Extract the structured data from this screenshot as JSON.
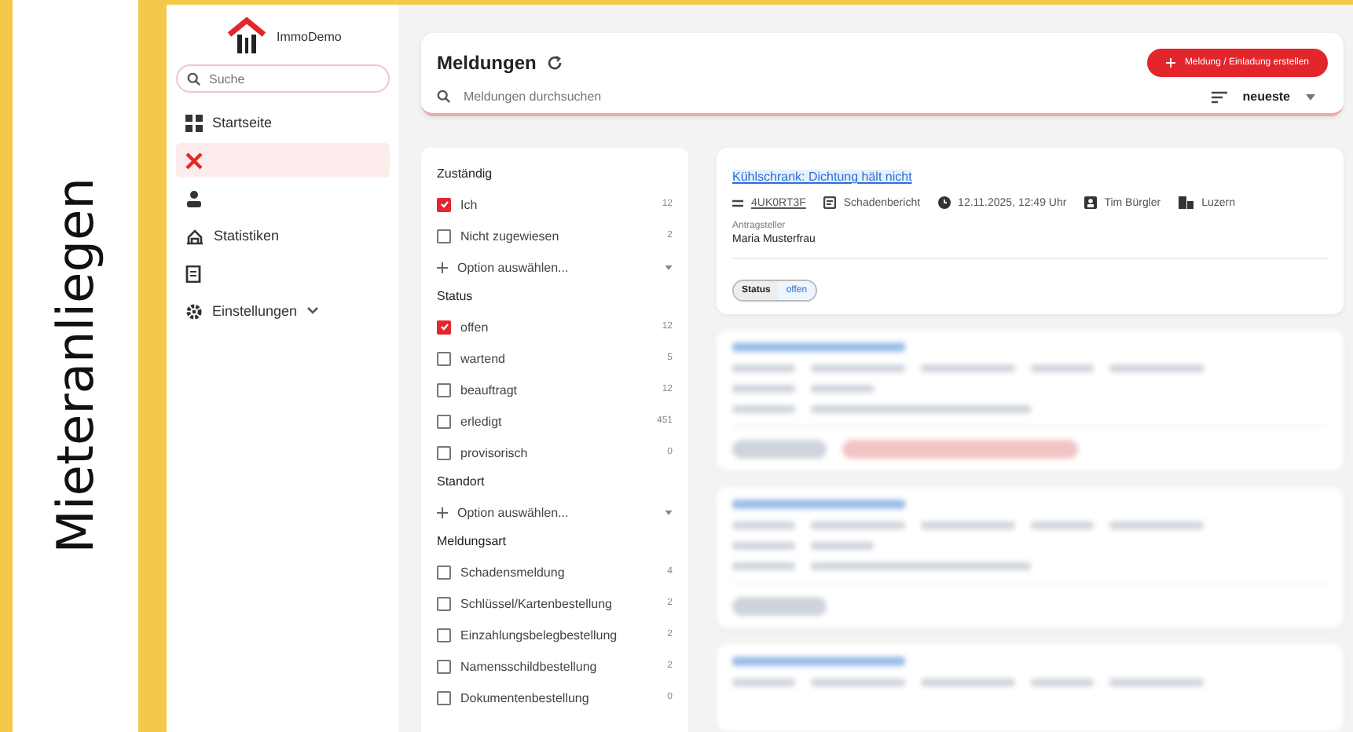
{
  "side_label": "Mieteranliegen",
  "sidebar": {
    "brand": "ImmoDemo",
    "search_placeholder": "Suche",
    "items": [
      {
        "kind": "grid",
        "label": "Startseite",
        "selected": false,
        "expandable": false
      },
      {
        "kind": "cross",
        "selected": true,
        "expandable": false
      },
      {
        "kind": "person",
        "selected": false,
        "expandable": false
      },
      {
        "kind": "chart",
        "label": "Statistiken",
        "selected": false,
        "expandable": false
      },
      {
        "kind": "doc",
        "selected": false,
        "expandable": false
      },
      {
        "kind": "gear",
        "label": "Einstellungen",
        "selected": false,
        "expandable": true
      }
    ]
  },
  "header": {
    "title": "Meldungen",
    "create_button": "Meldung / Einladung erstellen",
    "search_placeholder": "Meldungen durchsuchen",
    "sort": "neueste"
  },
  "filters": [
    {
      "title": "Zuständig",
      "items": [
        {
          "kind": "check",
          "label": "Ich",
          "count": "12",
          "checked": true
        },
        {
          "kind": "check",
          "label": "Nicht zugewiesen",
          "count": "2",
          "checked": false
        },
        {
          "kind": "select",
          "label": "Option auswählen..."
        }
      ]
    },
    {
      "title": "Status",
      "items": [
        {
          "kind": "check",
          "label": "offen",
          "count": "12",
          "checked": true
        },
        {
          "kind": "check",
          "label": "wartend",
          "count": "5",
          "checked": false
        },
        {
          "kind": "check",
          "label": "beauftragt",
          "count": "12",
          "checked": false
        },
        {
          "kind": "check",
          "label": "erledigt",
          "count": "451",
          "checked": false
        },
        {
          "kind": "check",
          "label": "provisorisch",
          "count": "0",
          "checked": false
        }
      ]
    },
    {
      "title": "Standort",
      "items": [
        {
          "kind": "select",
          "label": "Option auswählen..."
        }
      ]
    },
    {
      "title": "Meldungsart",
      "items": [
        {
          "kind": "check",
          "label": "Schadensmeldung",
          "count": "4",
          "checked": false
        },
        {
          "kind": "check",
          "label": "Schlüssel/Kartenbestellung",
          "count": "2",
          "checked": false
        },
        {
          "kind": "check",
          "label": "Einzahlungsbelegbestellung",
          "count": "2",
          "checked": false
        },
        {
          "kind": "check",
          "label": "Namensschildbestellung",
          "count": "2",
          "checked": false
        },
        {
          "kind": "check",
          "label": "Dokumentenbestellung",
          "count": "0",
          "checked": false
        }
      ]
    }
  ],
  "cards": [
    {
      "title": "Kühlschrank: Dichtung hält nicht",
      "id": "4UK0RT3F",
      "type": "Schadenbericht",
      "date": "12.11.2025, 12:49 Uhr",
      "assignee": "Tim Bürgler",
      "location": "Luzern",
      "requester_label": "Antragsteller",
      "requester": "Maria Musterfrau",
      "status_label": "Status",
      "status": "offen"
    }
  ],
  "blurred_cards": [
    {
      "overdue": true
    },
    {
      "overdue": false
    }
  ],
  "more_cards_below": true
}
